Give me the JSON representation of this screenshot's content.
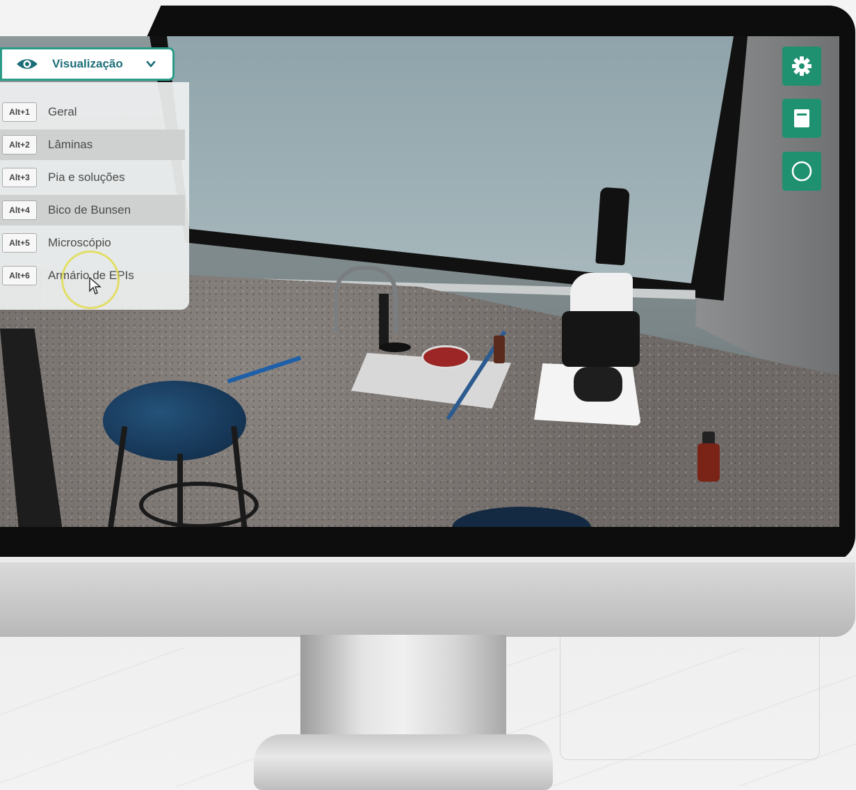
{
  "dropdown": {
    "label": "Visualização",
    "icon": "eye-icon",
    "accent_color": "#2b9b87"
  },
  "menu": {
    "items": [
      {
        "shortcut": "Alt+1",
        "label": "Geral"
      },
      {
        "shortcut": "Alt+2",
        "label": "Lâminas"
      },
      {
        "shortcut": "Alt+3",
        "label": "Pia e soluções"
      },
      {
        "shortcut": "Alt+4",
        "label": "Bico de Bunsen"
      },
      {
        "shortcut": "Alt+5",
        "label": "Microscópio"
      },
      {
        "shortcut": "Alt+6",
        "label": "Armário de EPIs"
      }
    ]
  },
  "toolbar": {
    "buttons": [
      {
        "icon": "gear-icon"
      },
      {
        "icon": "document-icon"
      },
      {
        "icon": "circle-icon"
      }
    ],
    "color": "#1f9070"
  }
}
